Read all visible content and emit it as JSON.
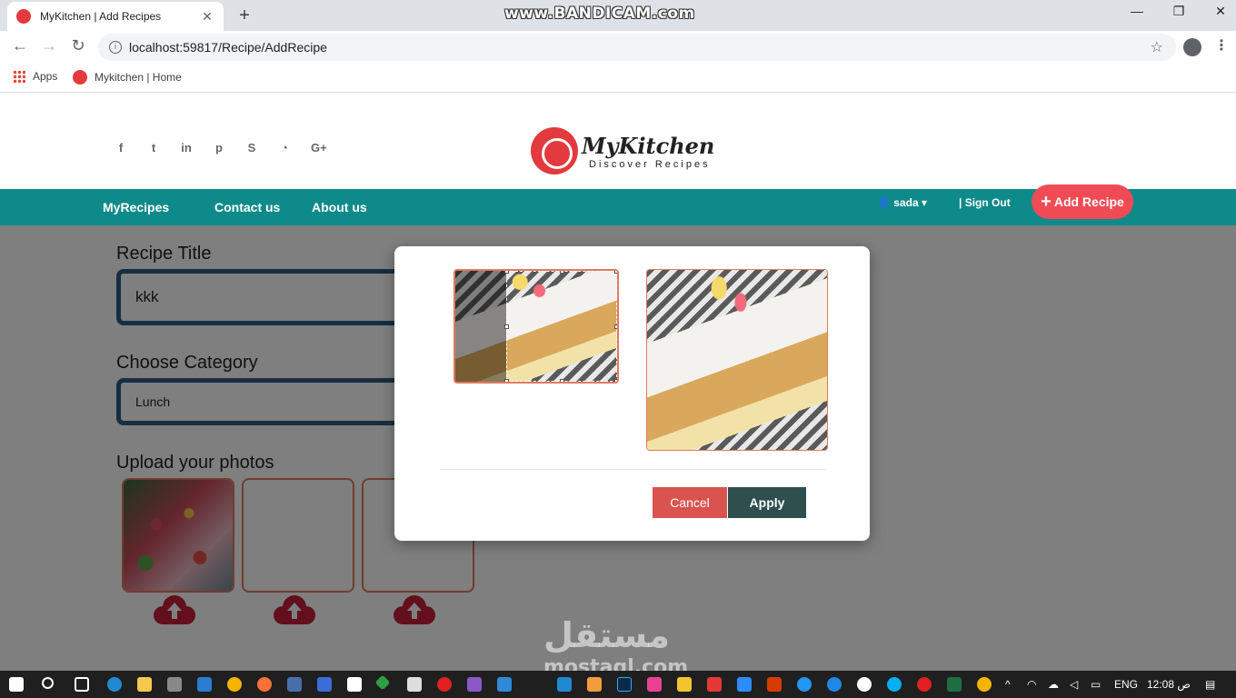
{
  "browser": {
    "tab_title": "MyKitchen | Add Recipes",
    "tab_close": "✕",
    "new_tab": "+",
    "url": "localhost:59817/Recipe/AddRecipe",
    "watermark": "www.BANDICAM.com",
    "bookmarks": [
      {
        "label": "Apps"
      },
      {
        "label": "Mykitchen | Home"
      }
    ],
    "window_controls": [
      "—",
      "❐",
      "✕"
    ]
  },
  "site": {
    "brand": "MyKitchen",
    "tagline": "Discover Recipes",
    "social_icons": [
      "facebook-icon",
      "twitter-icon",
      "linkedin-icon",
      "pinterest-icon",
      "skype-icon",
      "rss-icon",
      "google-plus-icon"
    ],
    "social_glyphs": [
      "f",
      "t",
      "in",
      "p",
      "S",
      "◔",
      "G+"
    ],
    "nav": {
      "my_recipes": "MyRecipes",
      "contact": "Contact us",
      "about": "About us",
      "user": "sada",
      "sign_out": "Sign Out",
      "add_recipe": "Add Recipe"
    }
  },
  "form": {
    "title_label": "Recipe Title",
    "title_value": "kkk",
    "category_label": "Choose Category",
    "category_value": "Lunch",
    "photos_label": "Upload your photos"
  },
  "modal": {
    "cancel": "Cancel",
    "apply": "Apply"
  },
  "watermark_bottom": {
    "line1": "مستقل",
    "line2": "mostaql.com"
  },
  "taskbar": {
    "lang": "ENG",
    "time": "ص 12:08"
  },
  "colors": {
    "nav_bg": "#0f8a8a",
    "accent_red": "#f04b55",
    "field_border": "#2e5c82",
    "cancel_bg": "#d9534f",
    "apply_bg": "#2f4f4f"
  }
}
